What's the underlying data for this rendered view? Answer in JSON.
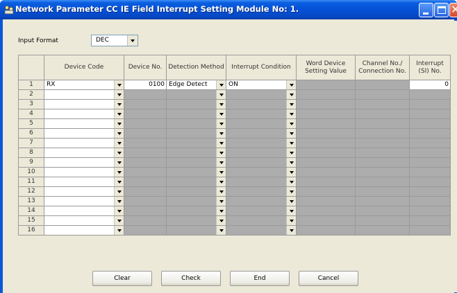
{
  "window": {
    "title": "Network Parameter CC IE Field Interrupt Setting Module No: 1.",
    "title_color": "#0a57d8"
  },
  "input_format": {
    "label": "Input Format",
    "value": "DEC"
  },
  "table": {
    "columns": {
      "device_code": "Device Code",
      "device_no": "Device No.",
      "detection_method": "Detection Method",
      "interrupt_condition": "Interrupt Condition",
      "word_device_setting": "Word Device Setting Value",
      "channel_connection": "Channel No./ Connection No.",
      "interrupt_si": "Interrupt (SI) No."
    },
    "rows": [
      {
        "num": "1",
        "device_code": "RX",
        "device_no": "0100",
        "detection_method": "Edge Detect",
        "interrupt_condition": "ON",
        "interrupt_si": "0"
      },
      {
        "num": "2"
      },
      {
        "num": "3"
      },
      {
        "num": "4"
      },
      {
        "num": "5"
      },
      {
        "num": "6"
      },
      {
        "num": "7"
      },
      {
        "num": "8"
      },
      {
        "num": "9"
      },
      {
        "num": "10"
      },
      {
        "num": "11"
      },
      {
        "num": "12"
      },
      {
        "num": "13"
      },
      {
        "num": "14"
      },
      {
        "num": "15"
      },
      {
        "num": "16"
      }
    ]
  },
  "buttons": {
    "clear": "Clear",
    "check": "Check",
    "end": "End",
    "cancel": "Cancel"
  }
}
